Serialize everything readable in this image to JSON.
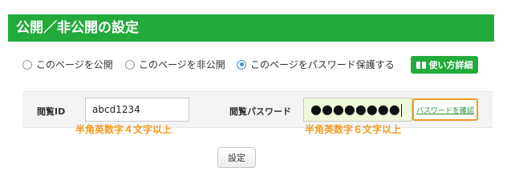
{
  "header": {
    "title": "公開／非公開の設定"
  },
  "visibility": {
    "options": [
      {
        "label": "このページを公開",
        "checked": false
      },
      {
        "label": "このページを非公開",
        "checked": false
      },
      {
        "label": "このページをパスワード保護する",
        "checked": true
      }
    ],
    "howto_label": "使い方詳細"
  },
  "form": {
    "id_label": "閲覧ID",
    "id_value": "abcd1234",
    "id_hint": "半角英数字４文字以上",
    "password_label": "閲覧パスワード",
    "password_value": "●●●●●●●●",
    "password_hint": "半角英数字６文字以上",
    "password_confirm_link": "パスワードを確認"
  },
  "actions": {
    "save_label": "設定"
  },
  "colors": {
    "brand": "#22ab3b",
    "highlight": "#f19a1f",
    "radio_selected": "#3b8fdc"
  }
}
